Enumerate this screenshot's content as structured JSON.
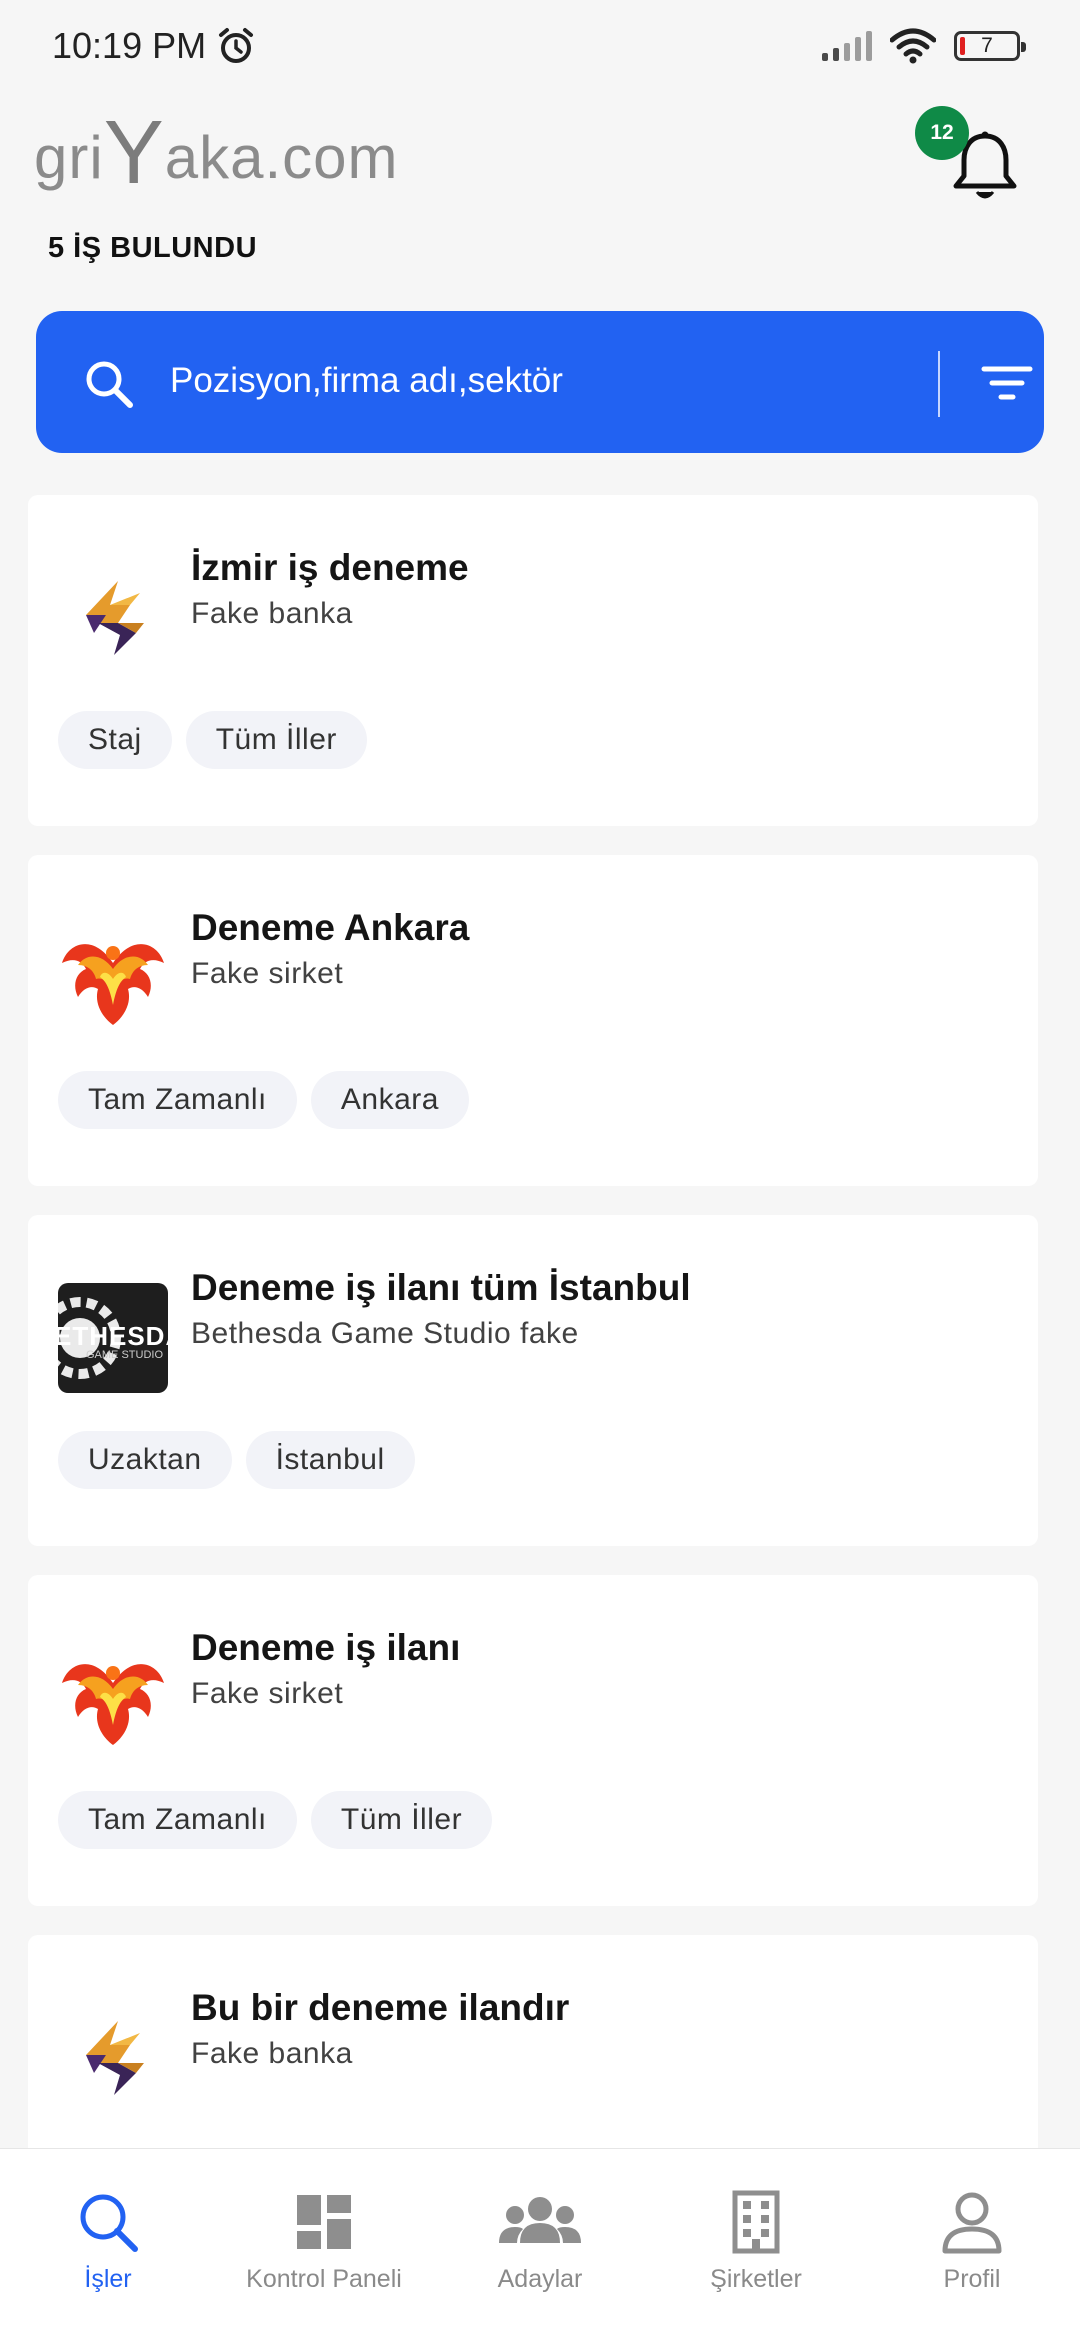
{
  "status_bar": {
    "time": "10:19 PM",
    "battery": "7"
  },
  "header": {
    "logo_small": "gri",
    "logo_big": "Y",
    "logo_rest": "aka.com",
    "notification_count": "12"
  },
  "results_count": "5 İŞ BULUNDU",
  "search": {
    "placeholder": "Pozisyon,firma adı,sektör"
  },
  "jobs": [
    {
      "title": "İzmir iş deneme",
      "company": "Fake banka",
      "logo": "bolt-logo",
      "tags": [
        "Staj",
        "Tüm İller"
      ]
    },
    {
      "title": "Deneme Ankara",
      "company": "Fake sirket",
      "logo": "phoenix-logo",
      "tags": [
        "Tam Zamanlı",
        "Ankara"
      ]
    },
    {
      "title": "Deneme iş ilanı tüm İstanbul",
      "company": "Bethesda Game Studio fake",
      "logo": "bethesda-logo",
      "tags": [
        "Uzaktan",
        "İstanbul"
      ]
    },
    {
      "title": "Deneme iş ilanı",
      "company": "Fake sirket",
      "logo": "phoenix-logo",
      "tags": [
        "Tam Zamanlı",
        "Tüm İller"
      ]
    },
    {
      "title": "Bu bir deneme ilandır",
      "company": "Fake banka",
      "logo": "bolt-logo",
      "tags": []
    }
  ],
  "bethesda_logo_text": {
    "main": "ETHESDA",
    "sub": "GAME STUDIO"
  },
  "nav": [
    {
      "label": "İşler",
      "icon": "search-icon",
      "active": true
    },
    {
      "label": "Kontrol Paneli",
      "icon": "dashboard-icon",
      "active": false
    },
    {
      "label": "Adaylar",
      "icon": "people-icon",
      "active": false
    },
    {
      "label": "Şirketler",
      "icon": "building-icon",
      "active": false
    },
    {
      "label": "Profil",
      "icon": "profile-icon",
      "active": false
    }
  ],
  "colors": {
    "accent": "#2262f2",
    "badge": "#0f8a47",
    "background": "#f6f6f6"
  }
}
